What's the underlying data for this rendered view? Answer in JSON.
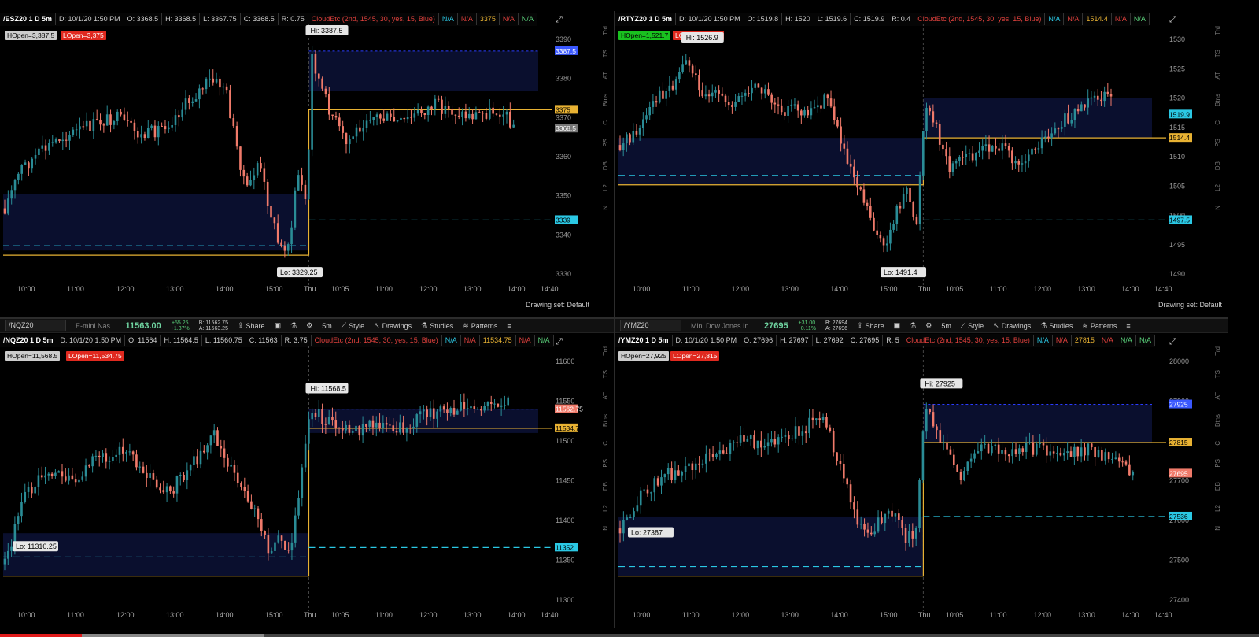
{
  "panes": [
    {
      "id": "es",
      "symbol": "/ESZ20 1 D 5m",
      "info": [
        "D: 10/1/20 1:50 PM",
        "O: 3368.5",
        "H: 3368.5",
        "L: 3367.75",
        "C: 3368.5",
        "R: 0.75"
      ],
      "cloud": "CloudEtc (2nd, 1545, 30, yes, 15, Blue)",
      "flags": [
        "N/A",
        "N/A",
        "3375",
        "N/A",
        "N/A"
      ],
      "flag_value": "3375",
      "hopen": "HOpen=3,387.5",
      "lopen": "LOpen=3,375",
      "hopen_color": "#cfcfcf",
      "hi_label": "Hi: 3387.5",
      "lo_label": "Lo: 3329.25",
      "price_axis": [
        "3390",
        "3380",
        "3370",
        "3360",
        "3350",
        "3340",
        "3330"
      ],
      "axis_tags": [
        {
          "text": "3387.5",
          "color": "#3a58ff",
          "fg": "#fff"
        },
        {
          "text": "3375",
          "color": "#e8b233",
          "fg": "#000"
        },
        {
          "text": "3368.5",
          "color": "#777",
          "fg": "#fff"
        },
        {
          "text": "3339",
          "color": "#2bc8e4",
          "fg": "#000"
        }
      ],
      "time_axis": [
        "10:00",
        "11:00",
        "12:00",
        "13:00",
        "14:00",
        "15:00",
        "Thu",
        "10:05",
        "11:00",
        "12:00",
        "13:00",
        "14:00",
        "14:40"
      ],
      "status": "Drawing set: Default"
    },
    {
      "id": "rty",
      "symbol": "/RTYZ20 1 D 5m",
      "info": [
        "D: 10/1/20 1:50 PM",
        "O: 1519.8",
        "H: 1520",
        "L: 1519.6",
        "C: 1519.9",
        "R: 0.4"
      ],
      "cloud": "CloudEtc (2nd, 1545, 30, yes, 15, Blue)",
      "flags": [
        "N/A",
        "N/A",
        "1514.4",
        "N/A",
        "N/A"
      ],
      "flag_value": "1514.4",
      "hopen": "HOpen=1,521.7",
      "lopen": "LOpen=1,514.4",
      "hopen_color": "#19c21f",
      "hi_label": "Hi: 1526.9",
      "lo_label": "Lo: 1491.4",
      "price_axis": [
        "1530",
        "1525",
        "1520",
        "1515",
        "1510",
        "1505",
        "1500",
        "1495",
        "1490"
      ],
      "axis_tags": [
        {
          "text": "1519.9",
          "color": "#2bc8e4",
          "fg": "#000"
        },
        {
          "text": "1514.4",
          "color": "#e8b233",
          "fg": "#000"
        },
        {
          "text": "1497.5",
          "color": "#2bc8e4",
          "fg": "#000"
        }
      ],
      "time_axis": [
        "10:00",
        "11:00",
        "12:00",
        "13:00",
        "14:00",
        "15:00",
        "Thu",
        "10:05",
        "11:00",
        "12:00",
        "13:00",
        "14:00",
        "14:40"
      ],
      "status": "Drawing set: Default"
    },
    {
      "id": "nq",
      "symbol": "/NQZ20 1 D 5m",
      "info": [
        "D: 10/1/20 1:50 PM",
        "O: 11564",
        "H: 11564.5",
        "L: 11560.75",
        "C: 11563",
        "R: 3.75"
      ],
      "cloud": "CloudEtc (2nd, 1545, 30, yes, 15, Blue)",
      "flags": [
        "N/A",
        "N/A",
        "11534.75",
        "N/A",
        "N/A"
      ],
      "flag_value": "11534.75",
      "hopen": "HOpen=11,568.5",
      "lopen": "LOpen=11,534.75",
      "hopen_color": "#cfcfcf",
      "hi_label": "Hi: 11568.5",
      "lo_label": "Lo: 11310.25",
      "price_axis": [
        "11600",
        "11550",
        "11500",
        "11450",
        "11400",
        "11350",
        "11300"
      ],
      "axis_tags": [
        {
          "text": "11562.75",
          "color": "#f07a6a",
          "fg": "#fff"
        },
        {
          "text": "11534.75",
          "color": "#e8b233",
          "fg": "#000"
        },
        {
          "text": "11352",
          "color": "#2bc8e4",
          "fg": "#000"
        }
      ],
      "time_axis": [
        "10:00",
        "11:00",
        "12:00",
        "13:00",
        "14:00",
        "15:00",
        "Thu",
        "10:05",
        "11:00",
        "12:00",
        "13:00",
        "14:00",
        "14:40"
      ],
      "toolbar": {
        "symbol": "/NQZ20",
        "desc": "E-mini Nas...",
        "price": "11563.00",
        "chg1": "+55.25",
        "chg2": "+1.37%",
        "bid": "B: 11562.75",
        "ask": "A: 11563.25"
      }
    },
    {
      "id": "ym",
      "symbol": "/YMZ20 1 D 5m",
      "info": [
        "D: 10/1/20 1:50 PM",
        "O: 27696",
        "H: 27697",
        "L: 27692",
        "C: 27695",
        "R: 5"
      ],
      "cloud": "CloudEtc (2nd, 1545, 30, yes, 15, Blue)",
      "flags": [
        "N/A",
        "N/A",
        "27815",
        "N/A",
        "N/A",
        "N/A"
      ],
      "flag_value": "27815",
      "hopen": "HOpen=27,925",
      "lopen": "LOpen=27,815",
      "hopen_color": "#cfcfcf",
      "hi_label": "Hi: 27925",
      "lo_label": "Lo: 27387",
      "price_axis": [
        "28000",
        "27900",
        "27800",
        "27700",
        "27600",
        "27500",
        "27400"
      ],
      "axis_tags": [
        {
          "text": "27925",
          "color": "#3a58ff",
          "fg": "#fff"
        },
        {
          "text": "27815",
          "color": "#e8b233",
          "fg": "#000"
        },
        {
          "text": "27695",
          "color": "#f07a6a",
          "fg": "#fff"
        },
        {
          "text": "27536",
          "color": "#2bc8e4",
          "fg": "#000"
        }
      ],
      "time_axis": [
        "10:00",
        "11:00",
        "12:00",
        "13:00",
        "14:00",
        "15:00",
        "Thu",
        "10:05",
        "11:00",
        "12:00",
        "13:00",
        "14:00",
        "14:40"
      ],
      "toolbar": {
        "symbol": "/YMZ20",
        "desc": "Mini Dow Jones In...",
        "price": "27695",
        "chg1": "+31.00",
        "chg2": "+0.11%",
        "bid": "B: 27694",
        "ask": "A: 27696"
      }
    }
  ],
  "toolbar_labels": {
    "share": "Share",
    "period": "5m",
    "style": "Style",
    "drawings": "Drawings",
    "studies": "Studies",
    "patterns": "Patterns"
  },
  "side_tabs": [
    "Trd",
    "TS",
    "AT",
    "Btns",
    "C",
    "PS",
    "DB",
    "L2",
    "N"
  ],
  "colors": {
    "up": "#2a8c96",
    "down": "#f07a6a",
    "cloud": "#0a0f2e",
    "dash": "#2bc8e4",
    "open_line": "#e8b233",
    "hopen_line": "#2a3cff"
  },
  "video_progress": {
    "played": 0.065,
    "buffered": 0.21
  }
}
